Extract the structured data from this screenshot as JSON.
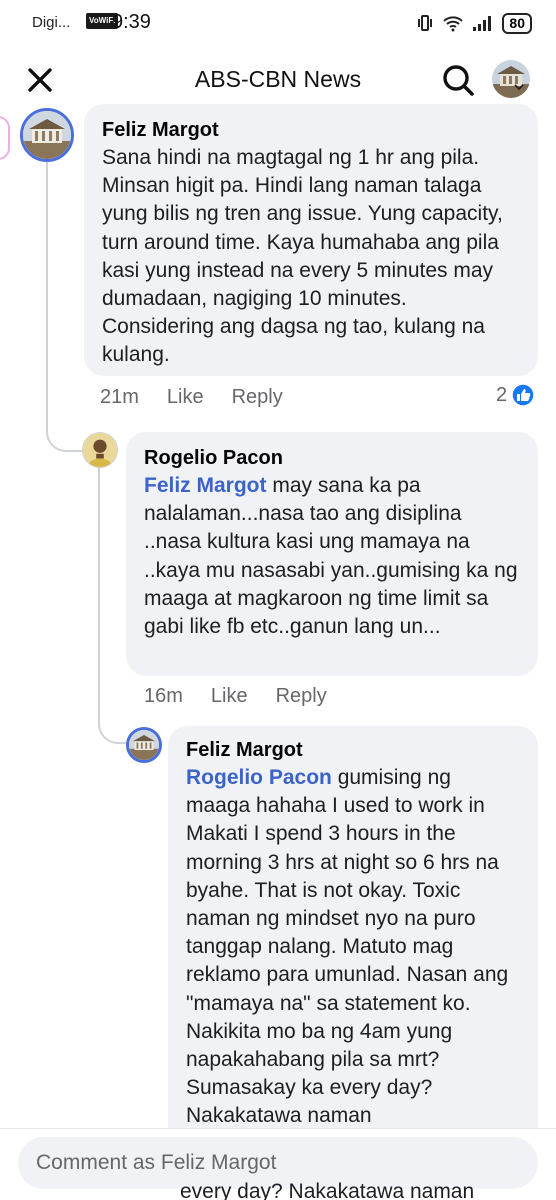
{
  "status_bar": {
    "carrier": "Digi...",
    "vowifi": "VoWiFi",
    "time": "9:39",
    "battery": "80"
  },
  "header": {
    "title": "ABS-CBN News"
  },
  "comments": [
    {
      "author": "Feliz Margot",
      "mention": "",
      "text": "Sana hindi na magtagal ng 1 hr ang pila. Minsan higit pa. Hindi lang naman talaga yung bilis ng tren ang issue. Yung capacity, turn around time. Kaya humahaba ang pila kasi yung instead na every 5 minutes may dumadaan, nagiging 10 minutes. Considering ang dagsa ng tao, kulang na kulang.",
      "time": "21m",
      "like": "Like",
      "reply": "Reply",
      "reaction_count": "2"
    },
    {
      "author": "Rogelio Pacon",
      "mention": "Feliz Margot",
      "text": " may sana ka pa nalalaman...nasa tao ang disiplina ..nasa kultura kasi ung mamaya na ..kaya mu nasasabi yan..gumising ka ng maaga at magkaroon ng time limit sa gabi like fb etc..ganun lang un...",
      "time": "16m",
      "like": "Like",
      "reply": "Reply"
    },
    {
      "author": "Feliz Margot",
      "mention": "Rogelio Pacon",
      "text": " gumising ng maaga hahaha I used to work in Makati I spend 3 hours in the morning 3 hrs at night so 6 hrs na byahe. That is not okay. Toxic naman ng mindset nyo na puro tanggap nalang. Matuto mag reklamo para umunlad. Nasan ang \"mamaya na\" sa statement ko. Nakikita mo ba ng 4am yung napakahabang pila sa mrt? Sumasakay ka every day? Nakakatawa naman"
    }
  ],
  "composer": {
    "placeholder": "Comment as Feliz Margot",
    "peek_text": "every day? Nakakatawa naman"
  },
  "colors": {
    "mention": "#3c63c8",
    "ring": "#4a6fdc",
    "bubble": "#f0f2f5",
    "like_reaction": "#1877f2"
  }
}
